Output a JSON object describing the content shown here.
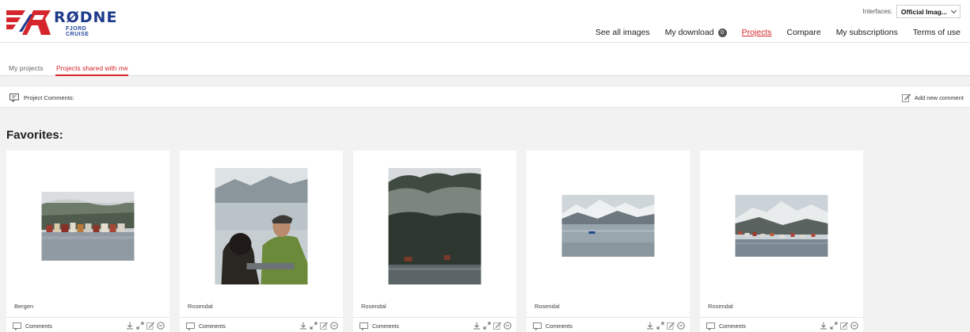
{
  "brand": {
    "name": "RØDNE",
    "subtitle": "FJORD CRUISE",
    "primary_color": "#d4262c",
    "secondary_color": "#1e3a8a"
  },
  "interfaces": {
    "label": "Interfaces:",
    "selected": "Official Imag..."
  },
  "nav": {
    "items": [
      {
        "label": "See all images"
      },
      {
        "label": "My download",
        "badge": "0"
      },
      {
        "label": "Projects",
        "active": true
      },
      {
        "label": "Compare"
      },
      {
        "label": "My subscriptions"
      },
      {
        "label": "Terms of use"
      }
    ]
  },
  "tabs": [
    {
      "label": "My projects",
      "active": false
    },
    {
      "label": "Projects shared with me",
      "active": true
    }
  ],
  "comments_bar": {
    "project_comments_label": "Project Comments:",
    "add_comment_label": "Add new comment"
  },
  "section": {
    "title": "Favorites:"
  },
  "cards": [
    {
      "title": "Bergen",
      "comments_label": "Comments",
      "image": "harbor-town-fog"
    },
    {
      "title": "Rosendal",
      "comments_label": "Comments",
      "image": "couple-on-boat-fjord"
    },
    {
      "title": "Rosendal",
      "comments_label": "Comments",
      "image": "snowy-forest-hillside"
    },
    {
      "title": "Rosendal",
      "comments_label": "Comments",
      "image": "fjord-boat-snow-mountains"
    },
    {
      "title": "Rosendal",
      "comments_label": "Comments",
      "image": "snowy-town-aerial"
    }
  ],
  "icons": {
    "comment": "comment-icon",
    "download": "download-icon",
    "expand": "expand-icon",
    "edit": "edit-icon",
    "remove": "remove-icon"
  }
}
